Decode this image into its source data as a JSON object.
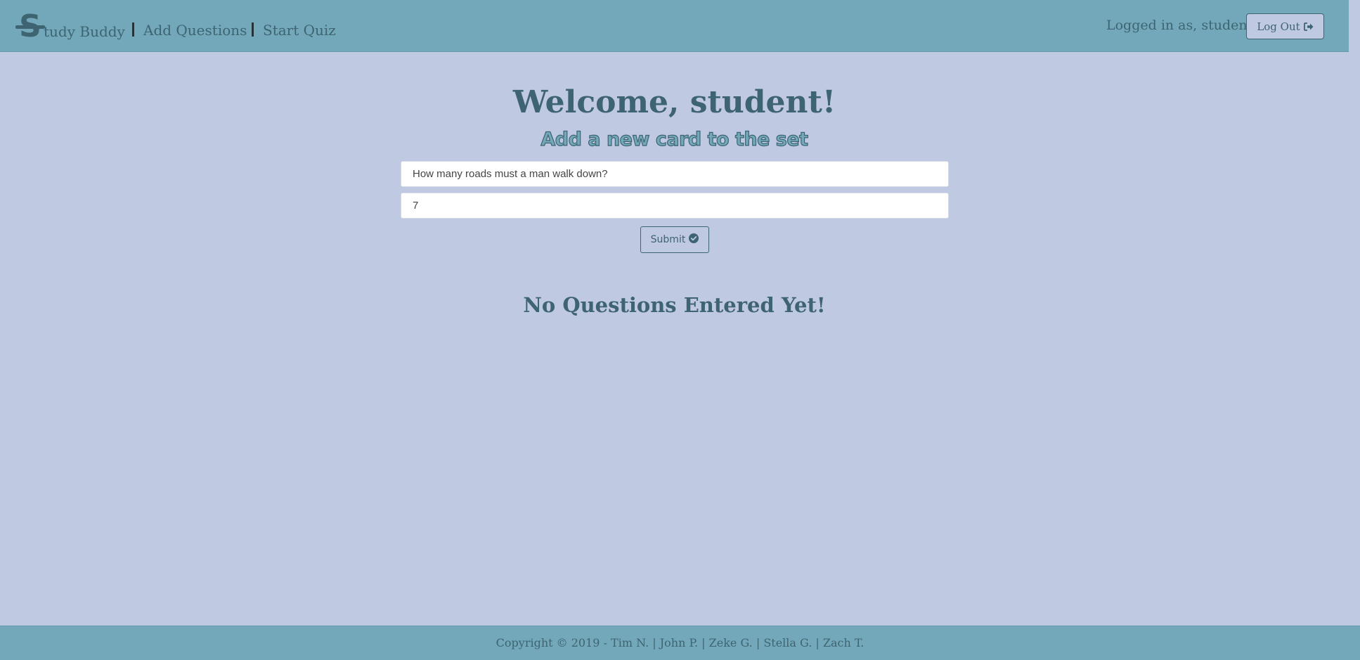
{
  "brand": {
    "logo_letter": "S",
    "name": "tudy Buddy"
  },
  "nav": {
    "add_questions": "Add Questions",
    "start_quiz": "Start Quiz"
  },
  "user": {
    "logged_in_text": "Logged in as, student",
    "logout_label": "Log Out"
  },
  "main": {
    "welcome": "Welcome, student!",
    "subtitle": "Add a new card to the set",
    "question_value": "How many roads must a man walk down?",
    "answer_value": "7",
    "submit_label": "Submit",
    "empty_message": "No Questions Entered Yet!"
  },
  "footer": {
    "copyright": "Copyright © 2019 - Tim N. | John P. | Zeke G. | Stella G. | Zach T."
  },
  "colors": {
    "page_bg": "#c0c9e2",
    "bar_bg": "#73a8bb",
    "text": "#3d6470"
  },
  "icons": {
    "logout": "sign-out-icon",
    "submit": "check-circle-icon"
  }
}
